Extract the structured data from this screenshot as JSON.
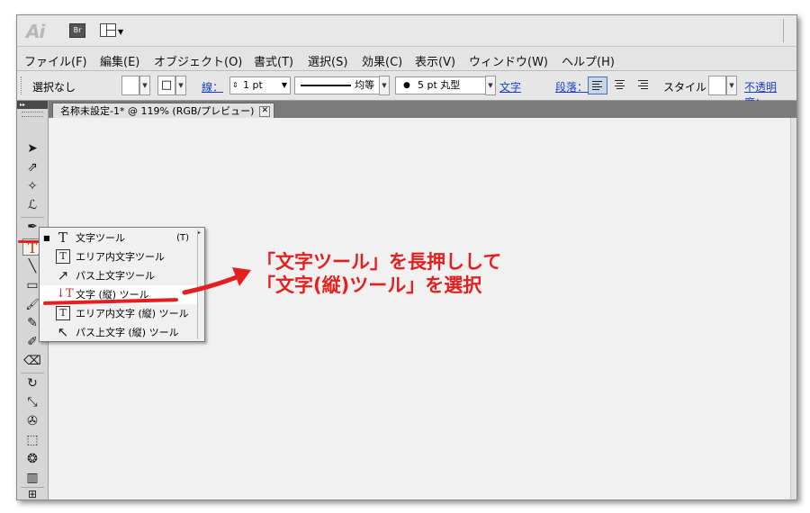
{
  "app": {
    "logo": "Ai",
    "bridge_button": "Br"
  },
  "menubar": {
    "items": [
      "ファイル(F)",
      "編集(E)",
      "オブジェクト(O)",
      "書式(T)",
      "選択(S)",
      "効果(C)",
      "表示(V)",
      "ウィンドウ(W)",
      "ヘルプ(H)"
    ]
  },
  "controlbar": {
    "selection": "選択なし",
    "stroke_label": "線：",
    "stroke_weight": "1 pt",
    "stroke_profile": "均等",
    "brush": "5 pt 丸型",
    "character_link": "文字",
    "paragraph_link": "段落：",
    "style_label": "スタイル：",
    "opacity_link": "不透明度："
  },
  "document": {
    "tab_title": "名称未設定-1* @ 119% (RGB/プレビュー)",
    "close_glyph": "✕"
  },
  "toolbox": {
    "header": "▸▸",
    "tools": [
      {
        "name": "selection-tool-icon",
        "glyph": "➤"
      },
      {
        "name": "direct-selection-tool-icon",
        "glyph": "⇗"
      },
      {
        "name": "magic-wand-tool-icon",
        "glyph": "✧"
      },
      {
        "name": "lasso-tool-icon",
        "glyph": "ℒ"
      },
      {
        "name": "pen-tool-icon",
        "glyph": "✒"
      },
      {
        "name": "type-tool-icon",
        "glyph": "T"
      },
      {
        "name": "line-tool-icon",
        "glyph": "╲"
      },
      {
        "name": "rectangle-tool-icon",
        "glyph": "▭"
      },
      {
        "name": "paintbrush-tool-icon",
        "glyph": "🖌"
      },
      {
        "name": "pencil-tool-icon",
        "glyph": "✎"
      },
      {
        "name": "blob-brush-tool-icon",
        "glyph": "✐"
      },
      {
        "name": "eraser-tool-icon",
        "glyph": "⌫"
      },
      {
        "name": "rotate-tool-icon",
        "glyph": "↻"
      },
      {
        "name": "scale-tool-icon",
        "glyph": "⤡"
      },
      {
        "name": "warp-tool-icon",
        "glyph": "✇"
      },
      {
        "name": "free-transform-tool-icon",
        "glyph": "⬚"
      },
      {
        "name": "symbol-sprayer-tool-icon",
        "glyph": "❂"
      },
      {
        "name": "graph-tool-icon",
        "glyph": "▥"
      },
      {
        "name": "artboard-tool-icon",
        "glyph": "⊞"
      }
    ]
  },
  "type_flyout": {
    "items": [
      {
        "label": "文字ツール",
        "shortcut": "(T)",
        "icon": "T",
        "selected": true
      },
      {
        "label": "エリア内文字ツール",
        "shortcut": "",
        "icon": "T"
      },
      {
        "label": "パス上文字ツール",
        "shortcut": "",
        "icon": "↗"
      },
      {
        "label": "文字 (縦) ツール",
        "shortcut": "",
        "icon": "↓T",
        "highlighted": true
      },
      {
        "label": "エリア内文字 (縦) ツール",
        "shortcut": "",
        "icon": "T"
      },
      {
        "label": "パス上文字 (縦) ツール",
        "shortcut": "",
        "icon": "↖"
      }
    ]
  },
  "annotation": {
    "line1": "「文字ツール」を長押しして",
    "line2": "「文字(縦)ツール」を選択",
    "color": "#e3201f"
  }
}
